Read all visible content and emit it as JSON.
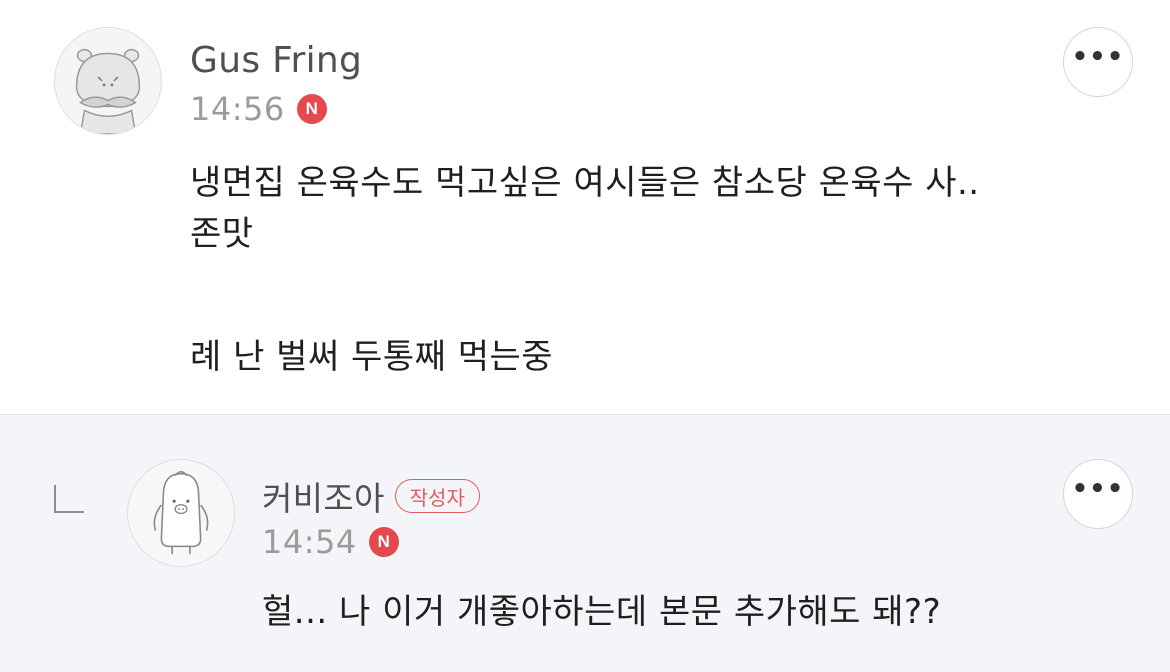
{
  "comments": [
    {
      "author": "Gus Fring",
      "time": "14:56",
      "new_badge": "N",
      "avatar_icon": "hippo-avatar-icon",
      "more_icon": "more-options-icon",
      "more_label": "•••",
      "lines": [
        "냉면집 온육수도 먹고싶은 여시들은 참소당 온육수 사..",
        "존맛",
        "",
        "례 난 벌써 두통째 먹는중"
      ]
    },
    {
      "author": "커비조아",
      "author_badge": "작성자",
      "time": "14:54",
      "new_badge": "N",
      "is_reply": true,
      "avatar_icon": "penguin-avatar-icon",
      "more_icon": "more-options-icon",
      "more_label": "•••",
      "lines": [
        "헐... 나 이거 개좋아하는데 본문 추가해도 돼??"
      ]
    }
  ],
  "colors": {
    "accent_red": "#e5484d",
    "reply_background": "#f4f5f9",
    "author_text": "#505050",
    "time_text": "#9b9b9b"
  }
}
